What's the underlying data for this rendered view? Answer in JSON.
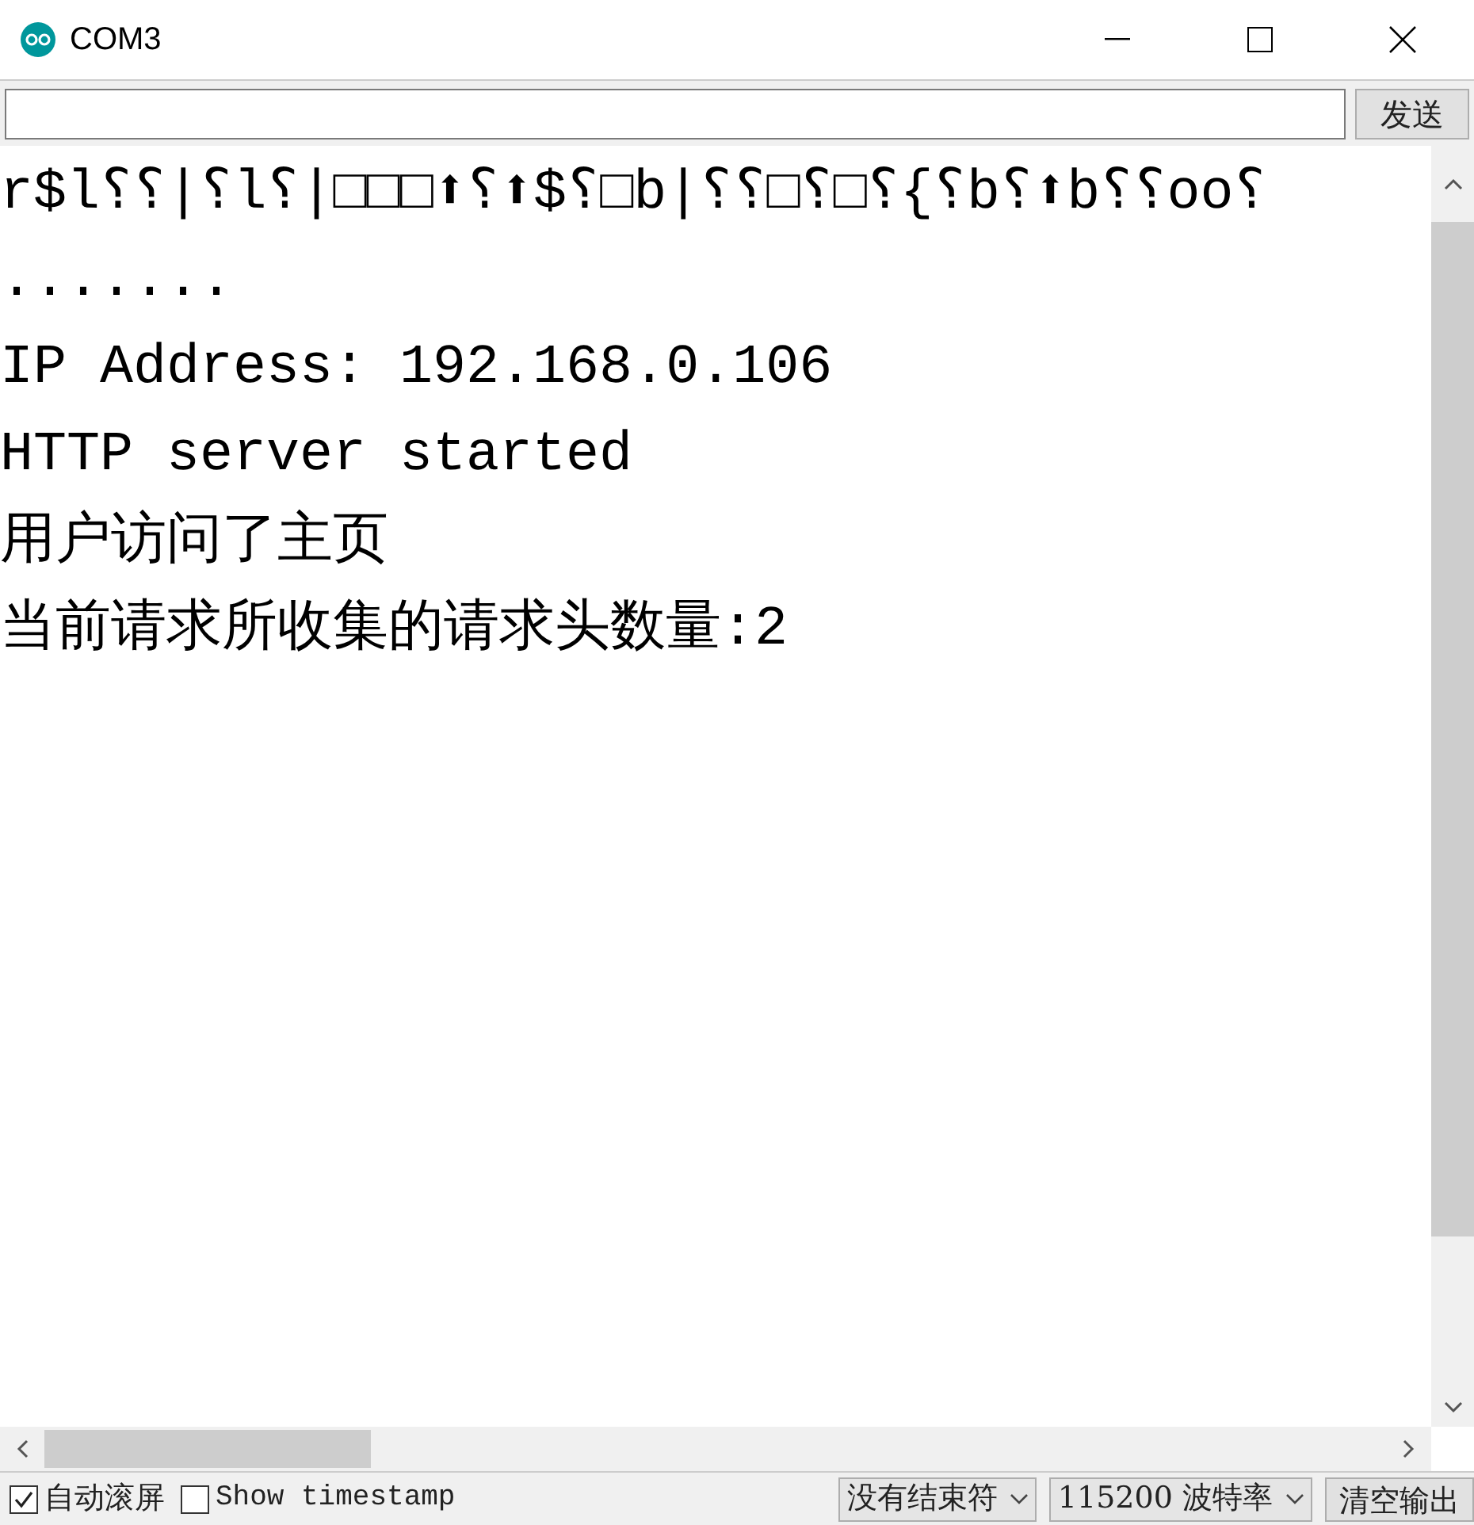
{
  "window": {
    "title": "COM3"
  },
  "send": {
    "button": "发送"
  },
  "output": {
    "lines": [
      "r$l⸮⸮|⸮l⸮|□□□⬆⸮⬆$⸮□b|⸮⸮□⸮□⸮{⸮b⸮⬆b⸮⸮oo⸮",
      ".......",
      "IP Address: 192.168.0.106",
      "HTTP server started",
      "用户访问了主页",
      "当前请求所收集的请求头数量:2"
    ]
  },
  "footer": {
    "autoscroll": {
      "label": "自动滚屏",
      "checked": true
    },
    "timestamp": {
      "label": "Show timestamp",
      "checked": false
    },
    "line_ending": "没有结束符",
    "baud": "115200 波特率",
    "clear_button": "清空输出"
  }
}
